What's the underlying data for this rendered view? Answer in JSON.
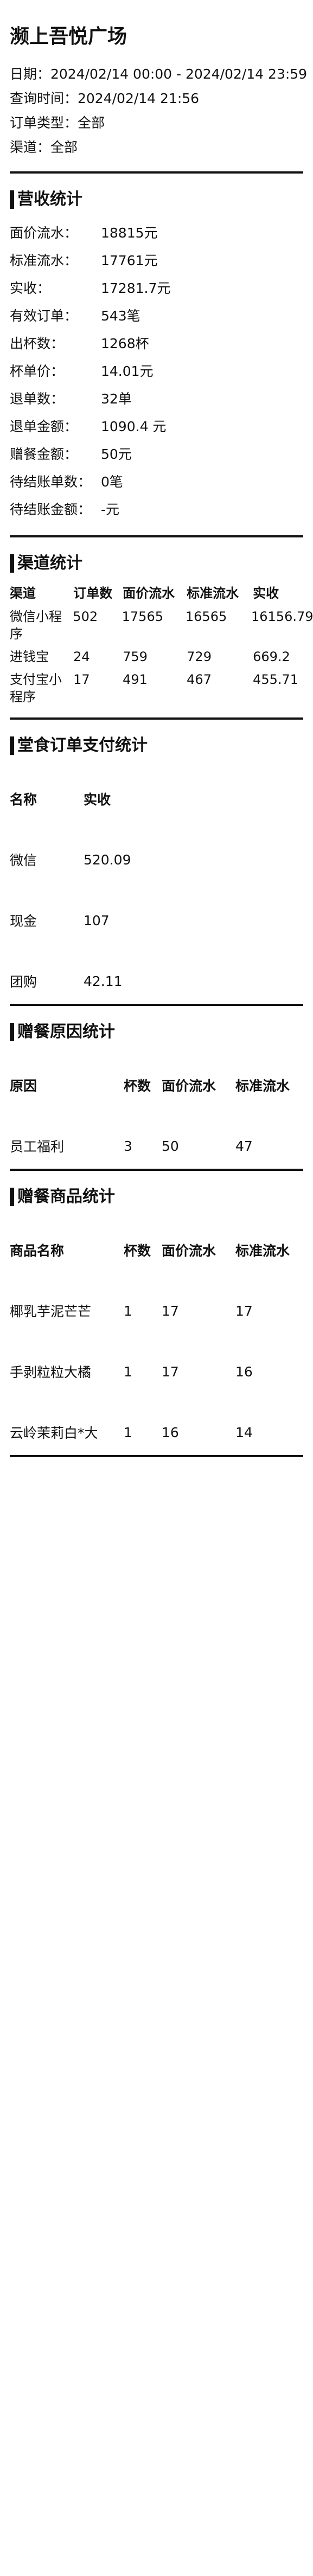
{
  "header": {
    "shop_name": "濒上吾悦广场",
    "date_range": "日期：2024/02/14 00:00 - 2024/02/14 23:59",
    "query_time": "查询时间：2024/02/14 21:56",
    "order_type": "订单类型：全部",
    "channel": "渠道：全部"
  },
  "revenue": {
    "title": "营收统计",
    "rows": [
      {
        "label": "面价流水：",
        "value": "18815元"
      },
      {
        "label": "标准流水：",
        "value": "17761元"
      },
      {
        "label": "实收：",
        "value": "17281.7元"
      },
      {
        "label": "有效订单：",
        "value": "543笔"
      },
      {
        "label": "出杯数：",
        "value": "1268杯"
      },
      {
        "label": "杯单价：",
        "value": "14.01元"
      },
      {
        "label": "退单数：",
        "value": "32单"
      },
      {
        "label": "退单金额：",
        "value": "1090.4 元"
      },
      {
        "label": "赠餐金额：",
        "value": "50元"
      },
      {
        "label": "待结账单数：",
        "value": "0笔"
      },
      {
        "label": "待结账金额：",
        "value": "-元"
      }
    ]
  },
  "channels": {
    "title": "渠道统计",
    "headers": [
      "渠道",
      "订单数",
      "面价流水",
      "标准流水",
      "实收"
    ],
    "rows": [
      [
        "微信小程序",
        "502",
        "17565",
        "16565",
        "16156.79"
      ],
      [
        "进钱宝",
        "24",
        "759",
        "729",
        "669.2"
      ],
      [
        "支付宝小程序",
        "17",
        "491",
        "467",
        "455.71"
      ]
    ]
  },
  "payment": {
    "title": "堂食订单支付统计",
    "headers": [
      "名称",
      "实收"
    ],
    "rows": [
      [
        "微信",
        "520.09"
      ],
      [
        "现金",
        "107"
      ],
      [
        "团购",
        "42.11"
      ]
    ]
  },
  "gift_reason": {
    "title": "赠餐原因统计",
    "headers": [
      "原因",
      "杯数",
      "面价流水",
      "标准流水"
    ],
    "rows": [
      [
        "员工福利",
        "3",
        "50",
        "47"
      ]
    ]
  },
  "gift_goods": {
    "title": "赠餐商品统计",
    "headers": [
      "商品名称",
      "杯数",
      "面价流水",
      "标准流水"
    ],
    "rows": [
      [
        "椰乳芋泥芒芒",
        "1",
        "17",
        "17"
      ],
      [
        "手剥粒粒大橘",
        "1",
        "17",
        "16"
      ],
      [
        "云岭茉莉白*大",
        "1",
        "16",
        "14"
      ]
    ]
  }
}
